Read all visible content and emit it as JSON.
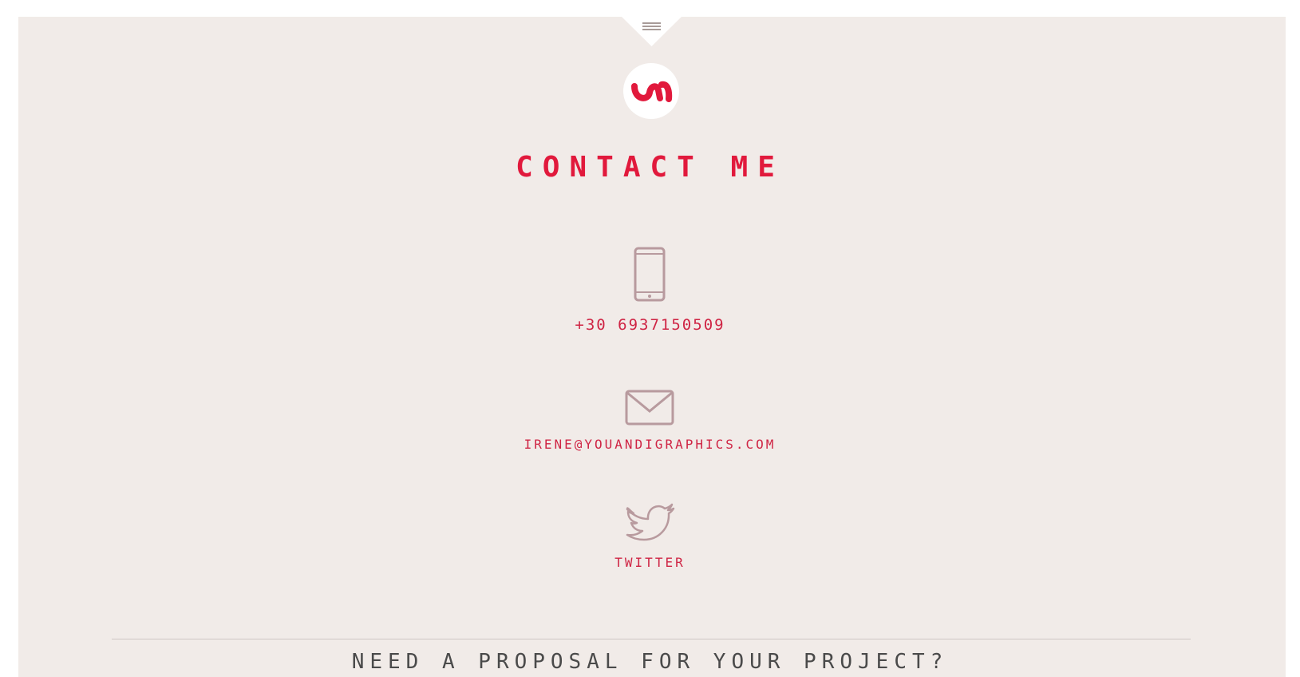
{
  "navigation": {
    "menu_icon": "hamburger-icon"
  },
  "brand": {
    "logo_icon": "brand-logo-icon"
  },
  "contact": {
    "title": "CONTACT ME",
    "phone": {
      "icon": "smartphone-icon",
      "label": "+30 6937150509"
    },
    "email": {
      "icon": "envelope-icon",
      "label": "IRENE@YOUANDIGRAPHICS.COM"
    },
    "twitter": {
      "icon": "twitter-bird-icon",
      "label": "TWITTER"
    }
  },
  "footer": {
    "proposal_heading": "NEED A PROPOSAL FOR YOUR PROJECT?"
  },
  "colors": {
    "accent": "#e1193c",
    "panel_background": "#f1ebe8",
    "icon_stroke": "#b89a9e",
    "heading_dark": "#4a4a4a"
  }
}
